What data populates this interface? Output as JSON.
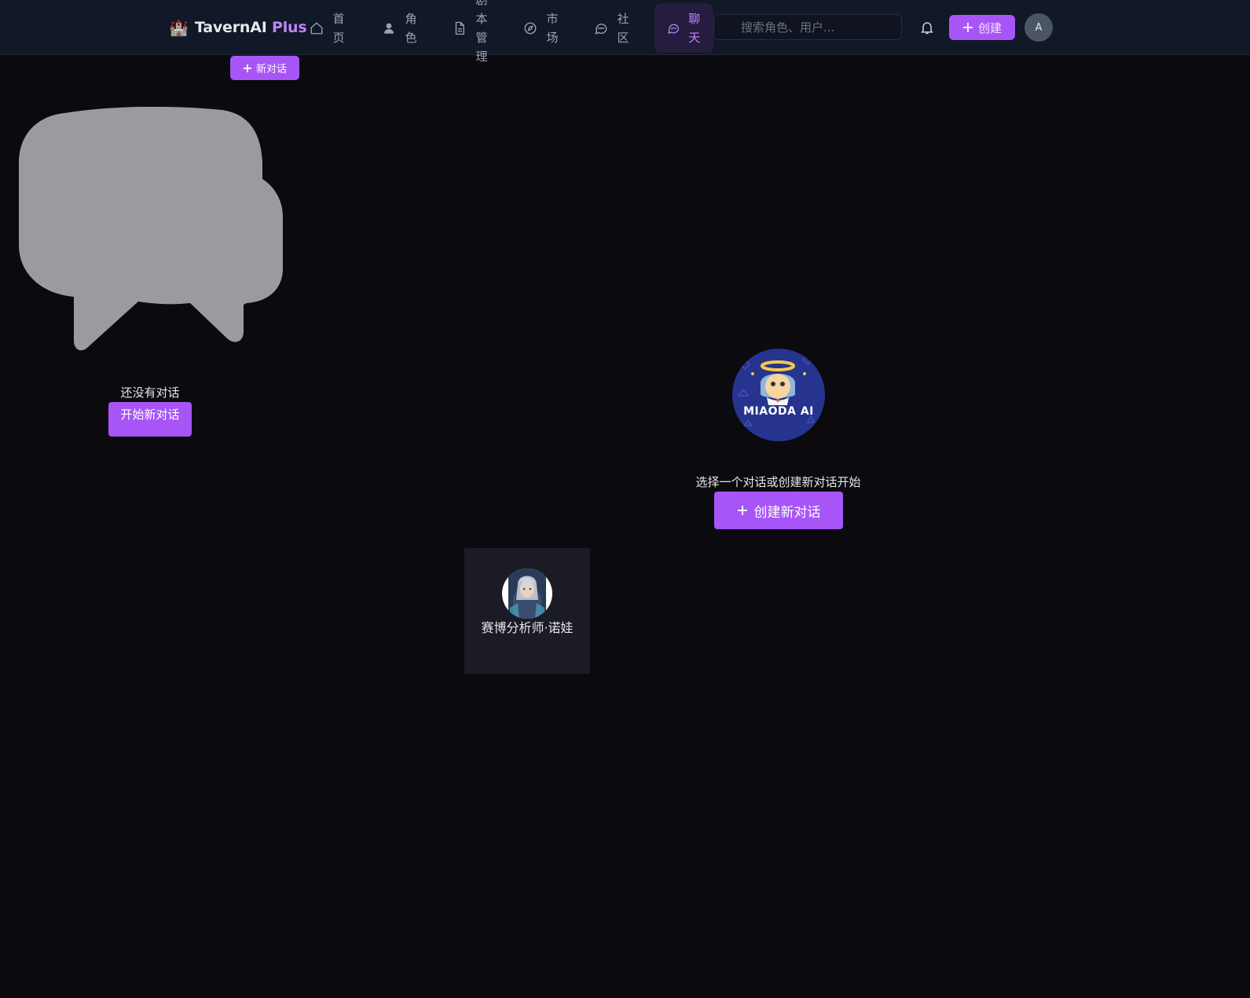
{
  "header": {
    "brand_logo": "🏰",
    "brand_name_part1": "TavernAI",
    "brand_name_part2": " Plus",
    "nav": [
      {
        "label": "首页",
        "icon": "home-icon",
        "active": false
      },
      {
        "label": "角色",
        "icon": "user-icon",
        "active": false
      },
      {
        "label": "剧本管理",
        "icon": "document-icon",
        "active": false
      },
      {
        "label": "市场",
        "icon": "compass-icon",
        "active": false
      },
      {
        "label": "社区",
        "icon": "message-circle-icon",
        "active": false
      },
      {
        "label": "聊天",
        "icon": "chat-icon",
        "active": true
      }
    ],
    "search_placeholder": "搜索角色、用户...",
    "create_label": "创建",
    "avatar_initial": "A"
  },
  "sidebar": {
    "new_chat_label": "新对话",
    "empty_text": "还没有对话",
    "start_new_label": "开始新对话"
  },
  "main": {
    "brand_badge": "MIAODA AI",
    "select_text": "选择一个对话或创建新对话开始",
    "create_new_label": "创建新对话"
  },
  "character_card": {
    "name": "赛博分析师·诺娃"
  },
  "colors": {
    "accent": "#a855f7",
    "active_nav_text": "#c084fc",
    "background": "#0a0a0f",
    "topbar": "#111827"
  }
}
